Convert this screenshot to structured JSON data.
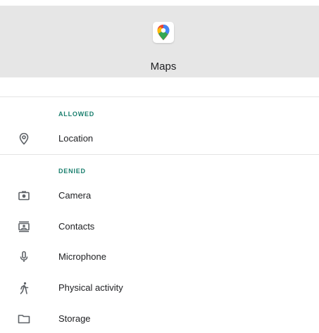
{
  "app": {
    "name": "Maps",
    "icon": "google-maps-pin-icon"
  },
  "sections": {
    "allowed": {
      "header": "ALLOWED",
      "items": [
        {
          "label": "Location",
          "icon": "location-pin-icon"
        }
      ]
    },
    "denied": {
      "header": "DENIED",
      "items": [
        {
          "label": "Camera",
          "icon": "camera-icon"
        },
        {
          "label": "Contacts",
          "icon": "contacts-icon"
        },
        {
          "label": "Microphone",
          "icon": "microphone-icon"
        },
        {
          "label": "Physical activity",
          "icon": "walking-person-icon"
        },
        {
          "label": "Storage",
          "icon": "folder-icon"
        }
      ]
    }
  },
  "colors": {
    "header_bg": "#e6e6e6",
    "section_header": "#1a7f6e",
    "icon": "#5f6368"
  }
}
